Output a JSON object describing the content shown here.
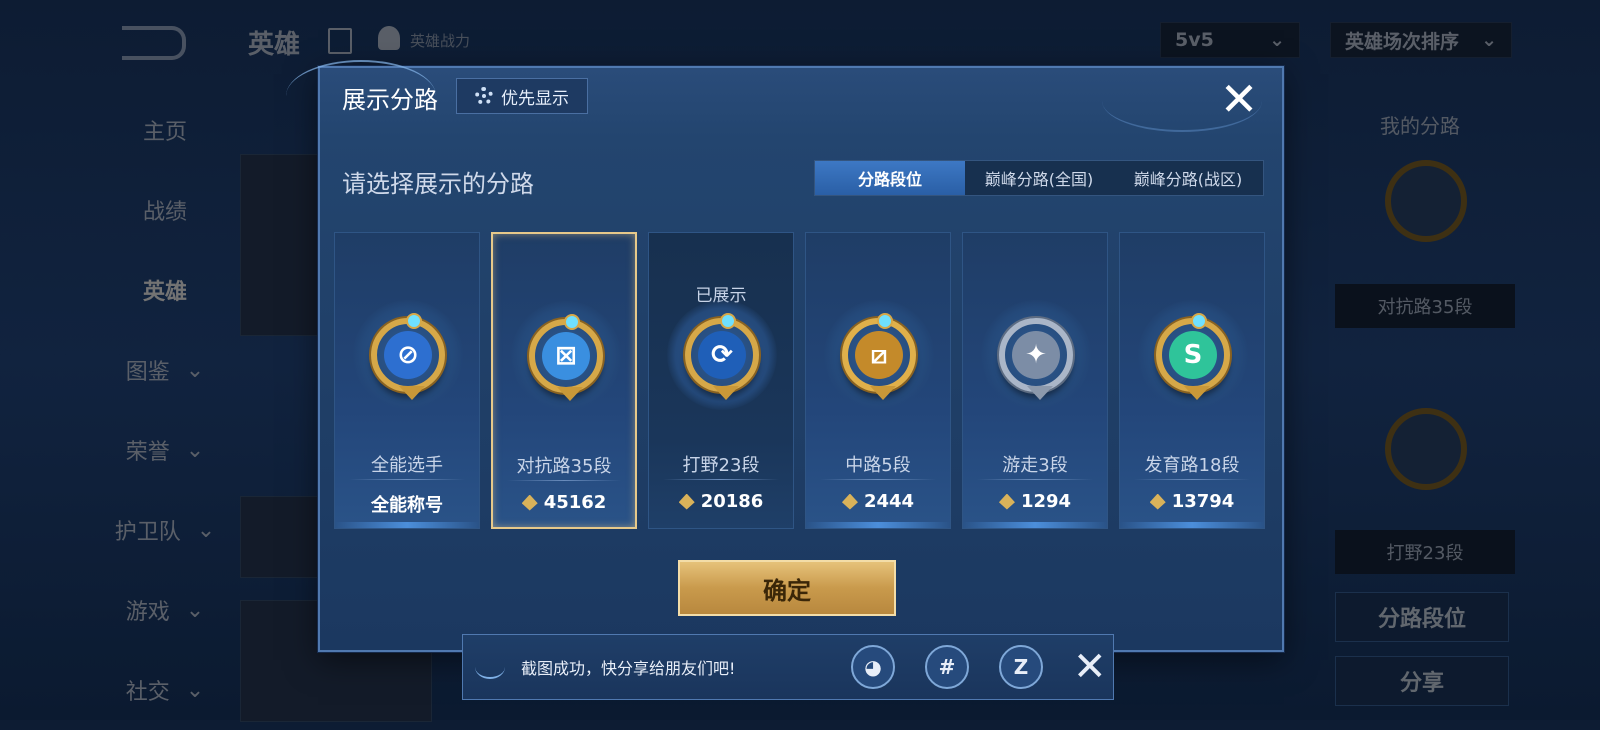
{
  "background": {
    "title": "英雄",
    "power_label": "英雄战力",
    "mode_select": "5v5",
    "sort_select": "英雄场次排序",
    "nav": [
      {
        "label": "主页"
      },
      {
        "label": "战绩"
      },
      {
        "label": "英雄"
      },
      {
        "label": "图鉴"
      },
      {
        "label": "荣誉"
      },
      {
        "label": "护卫队"
      },
      {
        "label": "游戏"
      },
      {
        "label": "社交"
      }
    ],
    "right_panel": {
      "title": "我的分路",
      "lane1_label": "对抗路35段",
      "lane2_label": "打野23段",
      "lane_rank_button": "分路段位",
      "share_button": "分享"
    }
  },
  "modal": {
    "title": "展示分路",
    "priority_button": "优先显示",
    "close_label": "✕",
    "prompt": "请选择展示的分路",
    "tabs": [
      {
        "label": "分路段位"
      },
      {
        "label": "巅峰分路(全国)"
      },
      {
        "label": "巅峰分路(战区)"
      }
    ],
    "cards": [
      {
        "name": "全能选手",
        "stat": "全能称号",
        "glyph": "⊘"
      },
      {
        "name": "对抗路35段",
        "stat": "45162",
        "glyph": "⊠"
      },
      {
        "name": "打野23段",
        "stat": "20186",
        "shown": "已展示",
        "glyph": "⟳"
      },
      {
        "name": "中路5段",
        "stat": "2444",
        "glyph": "⧄"
      },
      {
        "name": "游走3段",
        "stat": "1294",
        "glyph": "✦"
      },
      {
        "name": "发育路18段",
        "stat": "13794",
        "glyph": "S"
      }
    ],
    "confirm_button": "确定"
  },
  "toast": {
    "text": "截图成功，快分享给朋友们吧!",
    "icons": [
      "qq-icon",
      "wechat-icon",
      "qzone-icon"
    ],
    "icon_glyphs": [
      "◕",
      "#",
      "Z"
    ],
    "close_label": "✕"
  },
  "colors": {
    "accent_gold": "#e7c98a",
    "tab_active": "#3d78c4",
    "modal_bg": "#23456f"
  }
}
